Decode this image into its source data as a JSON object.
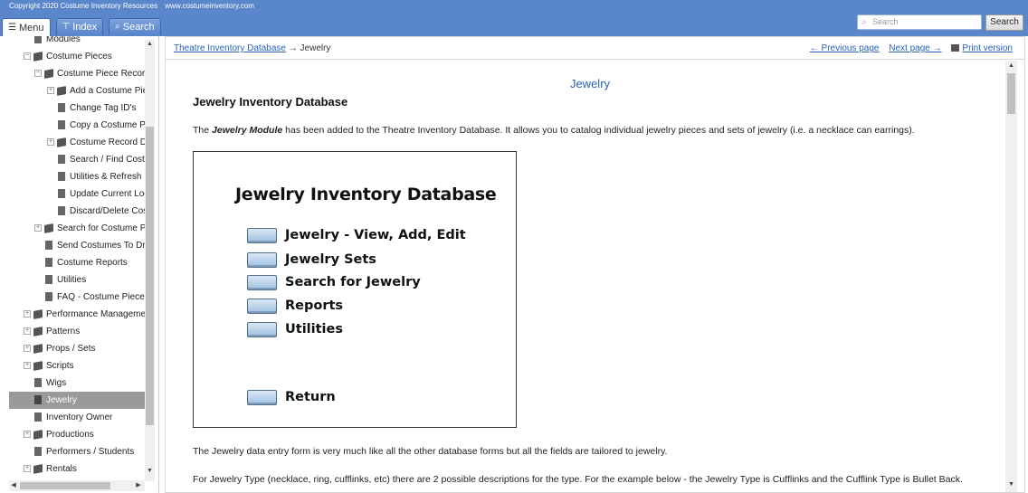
{
  "header": {
    "copyright": "Copyright 2020  Costume Inventory Resources",
    "website": "www.costumeinventory.com",
    "tabs": [
      {
        "label": "Menu",
        "icon": "menu-icon"
      },
      {
        "label": "Index",
        "icon": "index-icon"
      },
      {
        "label": "Search",
        "icon": "search-icon"
      }
    ],
    "search_placeholder": "Search",
    "search_button": "Search"
  },
  "sidebar": {
    "items": [
      {
        "label": "Modules"
      },
      {
        "label": "Costume Pieces"
      },
      {
        "label": "Costume Piece Records"
      },
      {
        "label": "Add a Costume Piece"
      },
      {
        "label": "Change Tag ID's"
      },
      {
        "label": "Copy a Costume Piece"
      },
      {
        "label": "Costume Record Details"
      },
      {
        "label": "Search / Find Costume"
      },
      {
        "label": "Utilities & Refresh Buttons"
      },
      {
        "label": "Update Current Location"
      },
      {
        "label": "Discard/Delete Costume"
      },
      {
        "label": "Search for Costume Pieces"
      },
      {
        "label": "Send Costumes To Dry Cleaning"
      },
      {
        "label": "Costume Reports"
      },
      {
        "label": "Utilities"
      },
      {
        "label": "FAQ - Costume Pieces"
      },
      {
        "label": "Performance Management"
      },
      {
        "label": "Patterns"
      },
      {
        "label": "Props / Sets"
      },
      {
        "label": "Scripts"
      },
      {
        "label": "Wigs"
      },
      {
        "label": "Jewelry"
      },
      {
        "label": "Inventory Owner"
      },
      {
        "label": "Productions"
      },
      {
        "label": "Performers / Students"
      },
      {
        "label": "Rentals"
      }
    ]
  },
  "breadcrumb": {
    "root": "Theatre Inventory Database",
    "arrow": "→",
    "current": "Jewelry"
  },
  "nav": {
    "previous": "← Previous page",
    "next": "Next page →",
    "print": "Print version"
  },
  "doc": {
    "title": "Jewelry",
    "heading": "Jewelry Inventory Database",
    "intro_before": "The ",
    "intro_bold": "Jewelry Module",
    "intro_after": " has been added to the Theatre Inventory Database.  It allows you to catalog individual jewelry pieces and sets of jewelry (i.e. a necklace can earrings).",
    "para2": "The Jewelry data entry form is very much like all the other database forms but all the fields are tailored to jewelry.",
    "para3": "For Jewelry Type (necklace, ring, cufflinks, etc) there are 2 possible descriptions for the type.  For the example below - the Jewelry Type is Cufflinks and the Cufflink Type is Bullet Back."
  },
  "figure": {
    "title": "Jewelry Inventory Database",
    "buttons": [
      "Jewelry - View, Add, Edit",
      "Jewelry Sets",
      "Search for Jewelry",
      "Reports",
      "Utilities"
    ],
    "return": "Return"
  }
}
